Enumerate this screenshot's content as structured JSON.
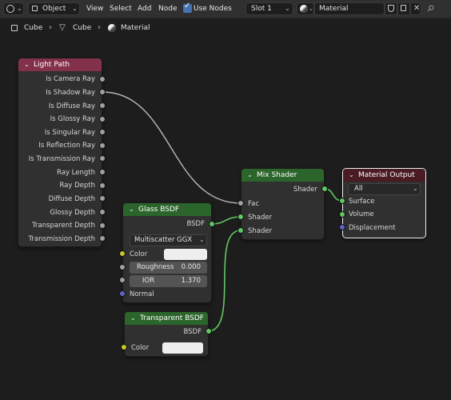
{
  "toolbar": {
    "object_mode": "Object",
    "menus": [
      "View",
      "Select",
      "Add",
      "Node"
    ],
    "use_nodes_label": "Use Nodes",
    "use_nodes_checked": true,
    "slot": "Slot 1",
    "material_name": "Material"
  },
  "breadcrumb": [
    "Cube",
    "Cube",
    "Material"
  ],
  "nodes": {
    "light_path": {
      "title": "Light Path",
      "outputs": [
        "Is Camera Ray",
        "Is Shadow Ray",
        "Is Diffuse Ray",
        "Is Glossy Ray",
        "Is Singular Ray",
        "Is Reflection Ray",
        "Is Transmission Ray",
        "Ray Length",
        "Ray Depth",
        "Diffuse Depth",
        "Glossy Depth",
        "Transparent Depth",
        "Transmission Depth"
      ]
    },
    "glass_bsdf": {
      "title": "Glass BSDF",
      "output": "BSDF",
      "distribution": "Multiscatter GGX",
      "color_label": "Color",
      "roughness_label": "Roughness",
      "roughness_value": "0.000",
      "ior_label": "IOR",
      "ior_value": "1.370",
      "normal_label": "Normal"
    },
    "transparent_bsdf": {
      "title": "Transparent BSDF",
      "output": "BSDF",
      "color_label": "Color"
    },
    "mix_shader": {
      "title": "Mix Shader",
      "output": "Shader",
      "inputs": [
        "Fac",
        "Shader",
        "Shader"
      ]
    },
    "material_output": {
      "title": "Material Output",
      "target": "All",
      "inputs": [
        "Surface",
        "Volume",
        "Displacement"
      ]
    }
  },
  "colors": {
    "input_header": "#83314a",
    "shader_header": "#2b652b",
    "output_header": "#4a1b22",
    "wire_shader": "#63c763",
    "wire_float": "#b8b8b8"
  }
}
